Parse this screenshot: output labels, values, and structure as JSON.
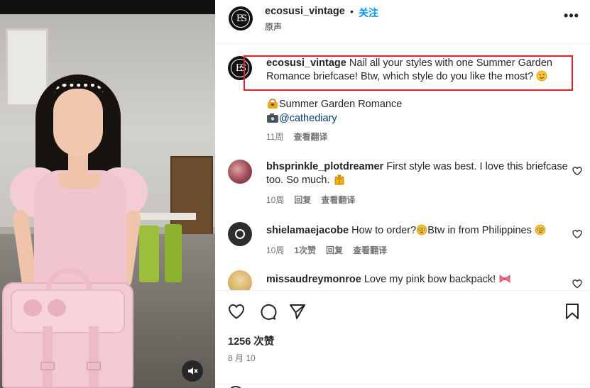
{
  "post": {
    "username": "ecosusi_vintage",
    "separator": "•",
    "follow_label": "关注",
    "subtitle": "原声",
    "more_label": "•••",
    "logo_text": "ES"
  },
  "caption": {
    "username": "ecosusi_vintage",
    "text": "Nail all your styles with one Summer Garden Romance briefcase! Btw, which style do you like the most?",
    "line1": "Summer Garden Romance",
    "line2_mention": "@cathediary",
    "time": "11周",
    "translate_label": "查看翻译"
  },
  "comments": [
    {
      "username": "bhsprinkle_plotdreamer",
      "text": "First style was best. I love this briefcase too. So much.",
      "time": "10周",
      "reply_label": "回复",
      "translate_label": "查看翻译"
    },
    {
      "username": "shielamaejacobe",
      "text_a": "How to order?",
      "text_b": "Btw in from Philippines",
      "time": "10周",
      "likes_label": "1次赞",
      "reply_label": "回复",
      "translate_label": "查看翻译"
    },
    {
      "username": "missaudreymonroe",
      "text": "Love my pink bow backpack!"
    }
  ],
  "footer": {
    "likes": "1256 次赞",
    "date": "8 月 10"
  },
  "icons": {
    "like": "heart-icon",
    "comment": "comment-icon",
    "share": "share-icon",
    "save": "bookmark-icon",
    "mute": "speaker-muted-icon"
  },
  "colors": {
    "follow": "#0095f6",
    "highlight_box": "#e81f28",
    "muted_text": "#737373",
    "mention": "#00376b"
  }
}
